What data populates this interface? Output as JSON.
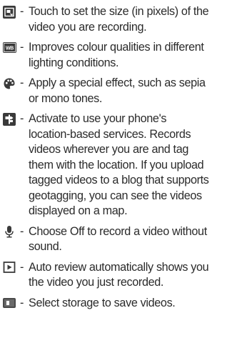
{
  "separator": "-",
  "items": [
    {
      "icon": "video-size-icon",
      "lines": [
        "Touch to set the size (in pixels) of the",
        "video you are recording."
      ]
    },
    {
      "icon": "white-balance-icon",
      "icon_text": "WB",
      "lines": [
        "Improves colour qualities in different",
        "lighting conditions."
      ]
    },
    {
      "icon": "colour-effect-palette-icon",
      "lines": [
        "Apply a special effect, such as sepia",
        "or mono tones."
      ]
    },
    {
      "icon": "location-tag-icon",
      "lines": [
        "Activate to use your phone's",
        "location-based services. Records",
        "videos wherever you are and tag",
        "them with the location. If you upload",
        "tagged videos to a blog that supports",
        "geotagging, you can see the videos",
        "displayed on a map."
      ]
    },
    {
      "icon": "microphone-icon",
      "lines": [
        "Choose Off to record a video without",
        "sound."
      ]
    },
    {
      "icon": "auto-review-icon",
      "lines": [
        "Auto review automatically shows you",
        "the video you just recorded."
      ]
    },
    {
      "icon": "storage-icon",
      "lines": [
        "Select storage to save videos."
      ]
    }
  ]
}
